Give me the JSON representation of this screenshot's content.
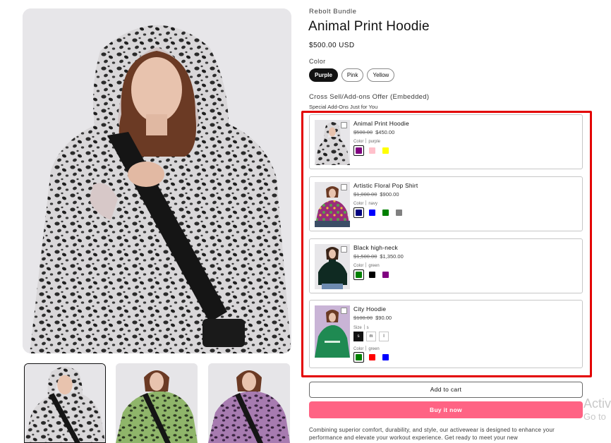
{
  "product": {
    "vendor": "Rebolt Bundle",
    "title": "Animal Print Hoodie",
    "price": "$500.00 USD",
    "color_label": "Color",
    "color_options": [
      {
        "label": "Purple",
        "selected": true
      },
      {
        "label": "Pink",
        "selected": false
      },
      {
        "label": "Yellow",
        "selected": false
      }
    ]
  },
  "offer": {
    "title": "Cross Sell/Add-ons Offer (Embedded)",
    "subtitle": "Special Add-Ons Just for You",
    "highlight_color": "#e30000",
    "items": [
      {
        "name": "Animal Print Hoodie",
        "compare_price": "$500.00",
        "price": "$450.00",
        "color_label": "Color",
        "color_value": "purple",
        "swatches": [
          {
            "name": "purple",
            "color": "#800080",
            "selected": true
          },
          {
            "name": "pink",
            "color": "#ffc0cb",
            "selected": false
          },
          {
            "name": "yellow",
            "color": "#ffff00",
            "selected": false
          }
        ]
      },
      {
        "name": "Artistic Floral Pop Shirt",
        "compare_price": "$1,000.00",
        "price": "$900.00",
        "color_label": "Color",
        "color_value": "navy",
        "swatches": [
          {
            "name": "navy",
            "color": "#000080",
            "selected": true
          },
          {
            "name": "blue",
            "color": "#0000ff",
            "selected": false
          },
          {
            "name": "green",
            "color": "#008000",
            "selected": false
          },
          {
            "name": "gray",
            "color": "#808080",
            "selected": false
          }
        ]
      },
      {
        "name": "Black high-neck",
        "compare_price": "$1,500.00",
        "price": "$1,350.00",
        "color_label": "Color",
        "color_value": "green",
        "swatches": [
          {
            "name": "green",
            "color": "#008000",
            "selected": true
          },
          {
            "name": "black",
            "color": "#000000",
            "selected": false
          },
          {
            "name": "purple",
            "color": "#800080",
            "selected": false
          }
        ]
      },
      {
        "name": "City Hoodie",
        "compare_price": "$100.00",
        "price": "$90.00",
        "size_label": "Size",
        "size_value": "s",
        "sizes": [
          {
            "label": "s",
            "selected": true
          },
          {
            "label": "m",
            "selected": false
          },
          {
            "label": "l",
            "selected": false
          }
        ],
        "color_label": "Color",
        "color_value": "green",
        "swatches": [
          {
            "name": "green",
            "color": "#008000",
            "selected": true
          },
          {
            "name": "red",
            "color": "#ff0000",
            "selected": false
          },
          {
            "name": "blue",
            "color": "#0000ff",
            "selected": false
          }
        ]
      }
    ]
  },
  "actions": {
    "add_to_cart": "Add to cart",
    "buy_now": "Buy it now",
    "buy_now_color": "#ff6384"
  },
  "description": "Combining superior comfort, durability, and style, our activewear is designed to enhance your performance and elevate your workout experience. Get ready to meet your new",
  "watermark": {
    "line1": "Activ",
    "line2": "Go to"
  },
  "icons": {
    "checkbox": "checkbox-icon"
  }
}
